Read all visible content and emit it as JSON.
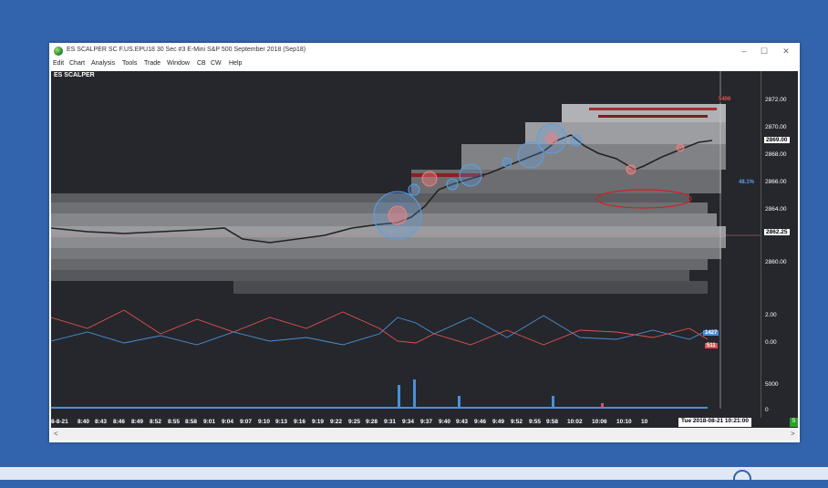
{
  "window": {
    "title": "ES SCALPER  SC F.US.EPU18  30 Sec   #3  E-Mini S&P 500  September 2018 (Sep18)",
    "controls": {
      "minimize": "–",
      "maximize": "☐",
      "close": "✕"
    }
  },
  "menu": [
    "Edit",
    "Chart",
    "Analysis",
    "Tools",
    "Trade",
    "Window",
    "CB",
    "CW",
    "Help"
  ],
  "chart": {
    "title": "ES SCALPER",
    "price_ticks": [
      "2872.00",
      "2870.00",
      "2868.00",
      "2866.00",
      "2864.00",
      "2860.00"
    ],
    "current_price": "2869.00",
    "crosshair_price": "2862.25",
    "volume_pct": "48.1%",
    "ladder_top_value": "5406",
    "indicator_ticks": [
      "2.00",
      "0.00"
    ],
    "indicator_values": {
      "blue": "1427",
      "red": "511"
    },
    "volume_tick": "5000",
    "volume_zero": "0",
    "time_labels": [
      "8-8-21",
      "8:40",
      "8:43",
      "8:46",
      "8:49",
      "8:52",
      "8:55",
      "8:58",
      "9:01",
      "9:04",
      "9:07",
      "9:10",
      "9:13",
      "9:16",
      "9:19",
      "9:22",
      "9:25",
      "9:28",
      "9:31",
      "9:34",
      "9:37",
      "9:40",
      "9:43",
      "9:46",
      "9:49",
      "9:52",
      "9:55",
      "9:58",
      "10:02",
      "10:06",
      "10:10",
      "10"
    ],
    "date_time": "Tue 2018-08-21  10:21:00",
    "badge": "5",
    "colors": {
      "background": "#25272c",
      "blue_line": "#4a90d9",
      "red_line": "#e05050",
      "bubble_blue": "#5aa0e8",
      "bubble_red": "#f08080"
    }
  },
  "scrollbar": {
    "left_arrow": "<",
    "right_arrow": ">"
  }
}
